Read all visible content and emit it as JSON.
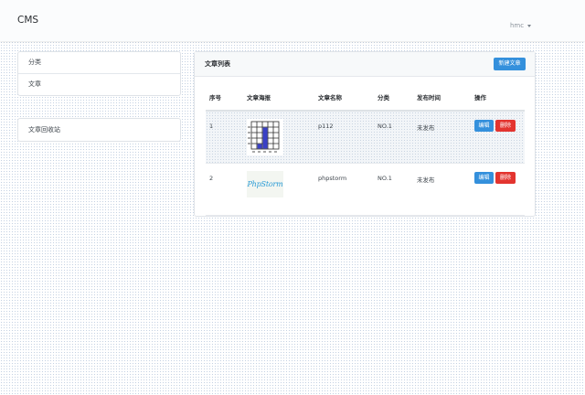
{
  "navbar": {
    "brand": "CMS",
    "user": "hmc"
  },
  "sidebar": {
    "items": [
      {
        "label": "分类"
      },
      {
        "label": "文章"
      }
    ],
    "recycle": {
      "label": "文章回收站"
    }
  },
  "main": {
    "title": "文章列表",
    "new_button": "新建文章",
    "columns": [
      "序号",
      "文章海报",
      "文章名称",
      "分类",
      "发布时间",
      "操作"
    ],
    "rows": [
      {
        "index": "1",
        "poster_icon": "bar-chart-thumbnail",
        "name": "p112",
        "category": "NO.1",
        "publish_time": "未发布",
        "edit_label": "编辑",
        "delete_label": "删除"
      },
      {
        "index": "2",
        "poster_icon": "phpstorm-logo",
        "poster_text": "PhpStorm",
        "name": "phpstorm",
        "category": "NO.1",
        "publish_time": "未发布",
        "edit_label": "编辑",
        "delete_label": "删除"
      }
    ]
  },
  "colors": {
    "primary": "#3490dc",
    "danger": "#e3342f",
    "poster_bar": "#3a41c6"
  }
}
